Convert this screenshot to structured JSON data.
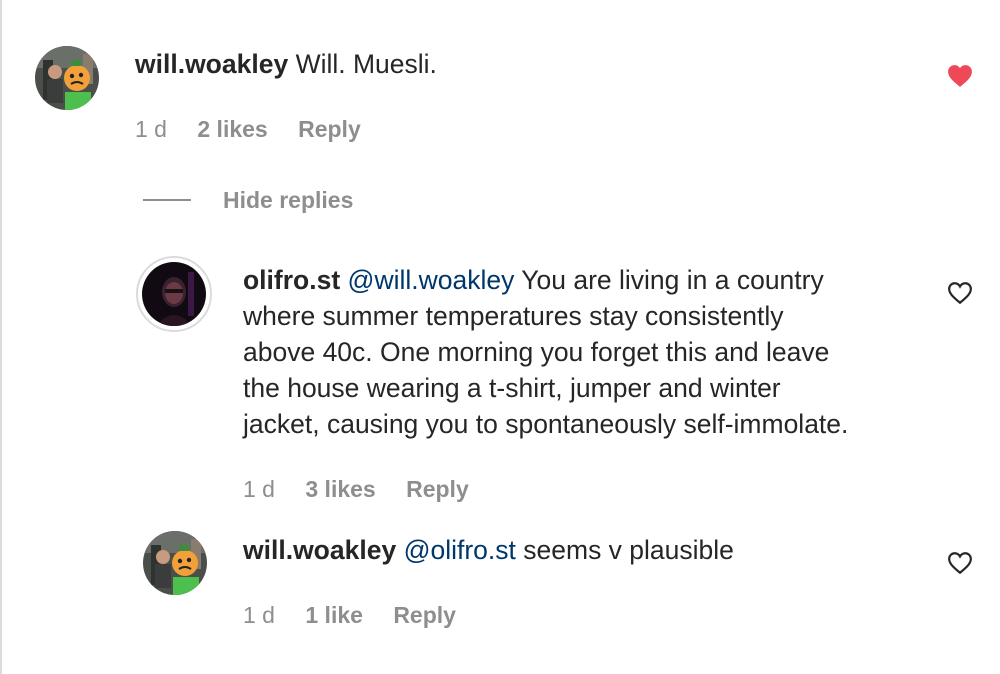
{
  "comments": [
    {
      "username": "will.woakley",
      "mention": "",
      "text": "Will. Muesli.",
      "time": "1 d",
      "likes": "2 likes",
      "reply": "Reply",
      "liked": true,
      "avatar_icon": "profile-photo-icon"
    }
  ],
  "hide_replies": "Hide replies",
  "replies": [
    {
      "username": "olifro.st",
      "mention": "@will.woakley",
      "lines": [
        "You are living in a country",
        "where summer temperatures stay consistently",
        "above 40c. One morning you forget this and leave",
        "the house wearing a t-shirt, jumper and winter",
        "jacket, causing you to spontaneously self-immolate."
      ],
      "time": "1 d",
      "likes": "3 likes",
      "reply": "Reply",
      "liked": false,
      "avatar_icon": "profile-photo-icon"
    },
    {
      "username": "will.woakley",
      "mention": "@olifro.st",
      "text": "seems v plausible",
      "time": "1 d",
      "likes": "1 like",
      "reply": "Reply",
      "liked": false,
      "avatar_icon": "profile-photo-icon"
    }
  ],
  "colors": {
    "liked_heart": "#ed4956",
    "mention": "#00376b",
    "meta": "#8e8e8e",
    "text": "#262626"
  }
}
